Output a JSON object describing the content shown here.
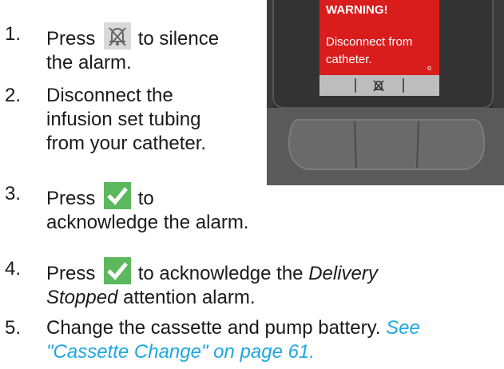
{
  "steps": [
    {
      "num": "1.",
      "pre": "Press",
      "post": "to silence",
      "line2": "the alarm.",
      "icon": "mute-alarm-icon"
    },
    {
      "num": "2.",
      "line1": "Disconnect the",
      "line2": "infusion set tubing",
      "line3": "from your catheter."
    },
    {
      "num": "3.",
      "pre": "Press",
      "post": "to",
      "line2": "acknowledge the alarm.",
      "icon": "checkmark-icon"
    },
    {
      "num": "4.",
      "pre": "Press",
      "post": "to acknowledge the",
      "italic1": "Delivery",
      "italic2": "Stopped",
      "line2_rest": "attention alarm.",
      "icon": "checkmark-icon"
    },
    {
      "num": "5.",
      "line1": "Change the cassette and pump battery.",
      "link1": "See",
      "link2": "\"Cassette Change\" on page 61."
    }
  ],
  "device": {
    "screen_title": "WARNING!",
    "screen_line1": "Disconnect from",
    "screen_line2": "catheter.",
    "screen_marker": "o",
    "colors": {
      "screen": "#d91d1d",
      "bar": "#bdbdbd",
      "check": "#5cb85c"
    }
  }
}
